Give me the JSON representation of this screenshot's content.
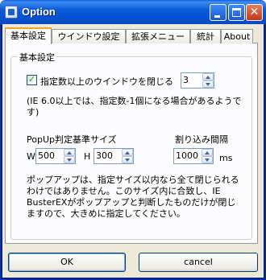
{
  "window": {
    "title": "Option"
  },
  "tabs": [
    {
      "label": "基本設定"
    },
    {
      "label": "ウインドウ設定"
    },
    {
      "label": "拡張メニュー"
    },
    {
      "label": "統計"
    },
    {
      "label": "About"
    }
  ],
  "group": {
    "label": "基本設定",
    "close_windows": {
      "label": "指定数以上のウインドウを閉じる",
      "checked": true,
      "value": "3"
    },
    "ie_note": "(IE 6.0以上では、指定数-1個になる場合があるようです)",
    "popup": {
      "size_label": "PopUp判定基準サイズ",
      "width_label": "W",
      "width_value": "500",
      "height_label": "H",
      "height_value": "300"
    },
    "interval": {
      "label": "割り込み間隔",
      "value": "1000",
      "unit": "ms"
    },
    "popup_note": "ポップアップは、指定サイズ以内なら全て閉じられるわけではありません。このサイズ内に合致し、IE BusterEXがポップアップと判断したものだけが閉じますので、大きめに指定してください。"
  },
  "buttons": {
    "ok": "OK",
    "cancel": "cancel"
  }
}
